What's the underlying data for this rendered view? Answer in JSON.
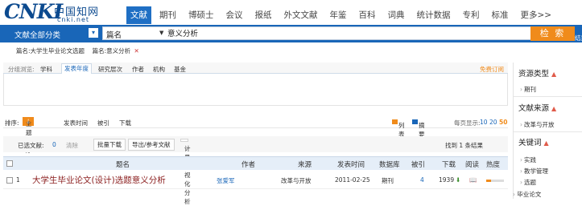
{
  "logo": {
    "text": "CNKI",
    "chinese": "中国知网",
    "url": "cnki.net"
  },
  "topnav": [
    {
      "label": "文献",
      "active": true
    },
    {
      "label": "期刊",
      "active": false
    },
    {
      "label": "博硕士",
      "active": false
    },
    {
      "label": "会议",
      "active": false
    },
    {
      "label": "报纸",
      "active": false
    },
    {
      "label": "外文文献",
      "active": false
    },
    {
      "label": "年鉴",
      "active": false
    },
    {
      "label": "百科",
      "active": false
    },
    {
      "label": "词典",
      "active": false
    },
    {
      "label": "统计数据",
      "active": false
    },
    {
      "label": "专利",
      "active": false
    },
    {
      "label": "标准",
      "active": false
    },
    {
      "label": "更多>>",
      "active": false
    }
  ],
  "search": {
    "category": "文献全部分类",
    "field": "篇名",
    "value": "意义分析",
    "button": "检 索",
    "result_label": "结果中检"
  },
  "breadcrumb": {
    "items": [
      "篇名:大学生毕业论文选题",
      "篇名:意义分析"
    ],
    "close": "✕"
  },
  "filter": {
    "label": "分组浏览:",
    "tabs": [
      "学科",
      "发表年度",
      "研究层次",
      "作者",
      "机构",
      "基金"
    ],
    "active": "发表年度",
    "free": "免费订阅"
  },
  "sort": {
    "label": "排序:",
    "options": [
      "主题排序",
      "发表时间",
      "被引",
      "下载"
    ],
    "active": "主题排序",
    "view_list": "列表",
    "view_summary": "摘要",
    "per_page_label": "每页显示:",
    "per_page": [
      "10",
      "20",
      "50"
    ],
    "per_page_active": "50"
  },
  "toolbar": {
    "selected_label": "已选文献:",
    "selected_count": "0",
    "clear": "清除",
    "batch_download": "批量下载",
    "export": "导出/参考文献",
    "visualize": "计量可视化分析",
    "found": "找到 1 条结果"
  },
  "table": {
    "headers": [
      "题名",
      "作者",
      "来源",
      "发表时间",
      "数据库",
      "被引",
      "下载",
      "阅读",
      "热度"
    ],
    "rows": [
      {
        "num": "1",
        "title": "大学生毕业论文(设计)选题意义分析",
        "author": "张爱军",
        "source": "改革与开放",
        "date": "2011-02-25",
        "database": "期刊",
        "cited": "4",
        "downloads": "1939",
        "heat": 0.25
      }
    ]
  },
  "sidebar": {
    "sections": [
      {
        "title": "资源类型",
        "items": [
          "期刊"
        ]
      },
      {
        "title": "文献来源",
        "items": [
          "改革与开放"
        ]
      },
      {
        "title": "关键词",
        "items": [
          "实践",
          "教学管理",
          "选题",
          "毕业论文"
        ]
      }
    ]
  },
  "colors": {
    "accent_blue": "#1966b8",
    "orange": "#f08b1b",
    "title_red": "#8a1c1c"
  }
}
